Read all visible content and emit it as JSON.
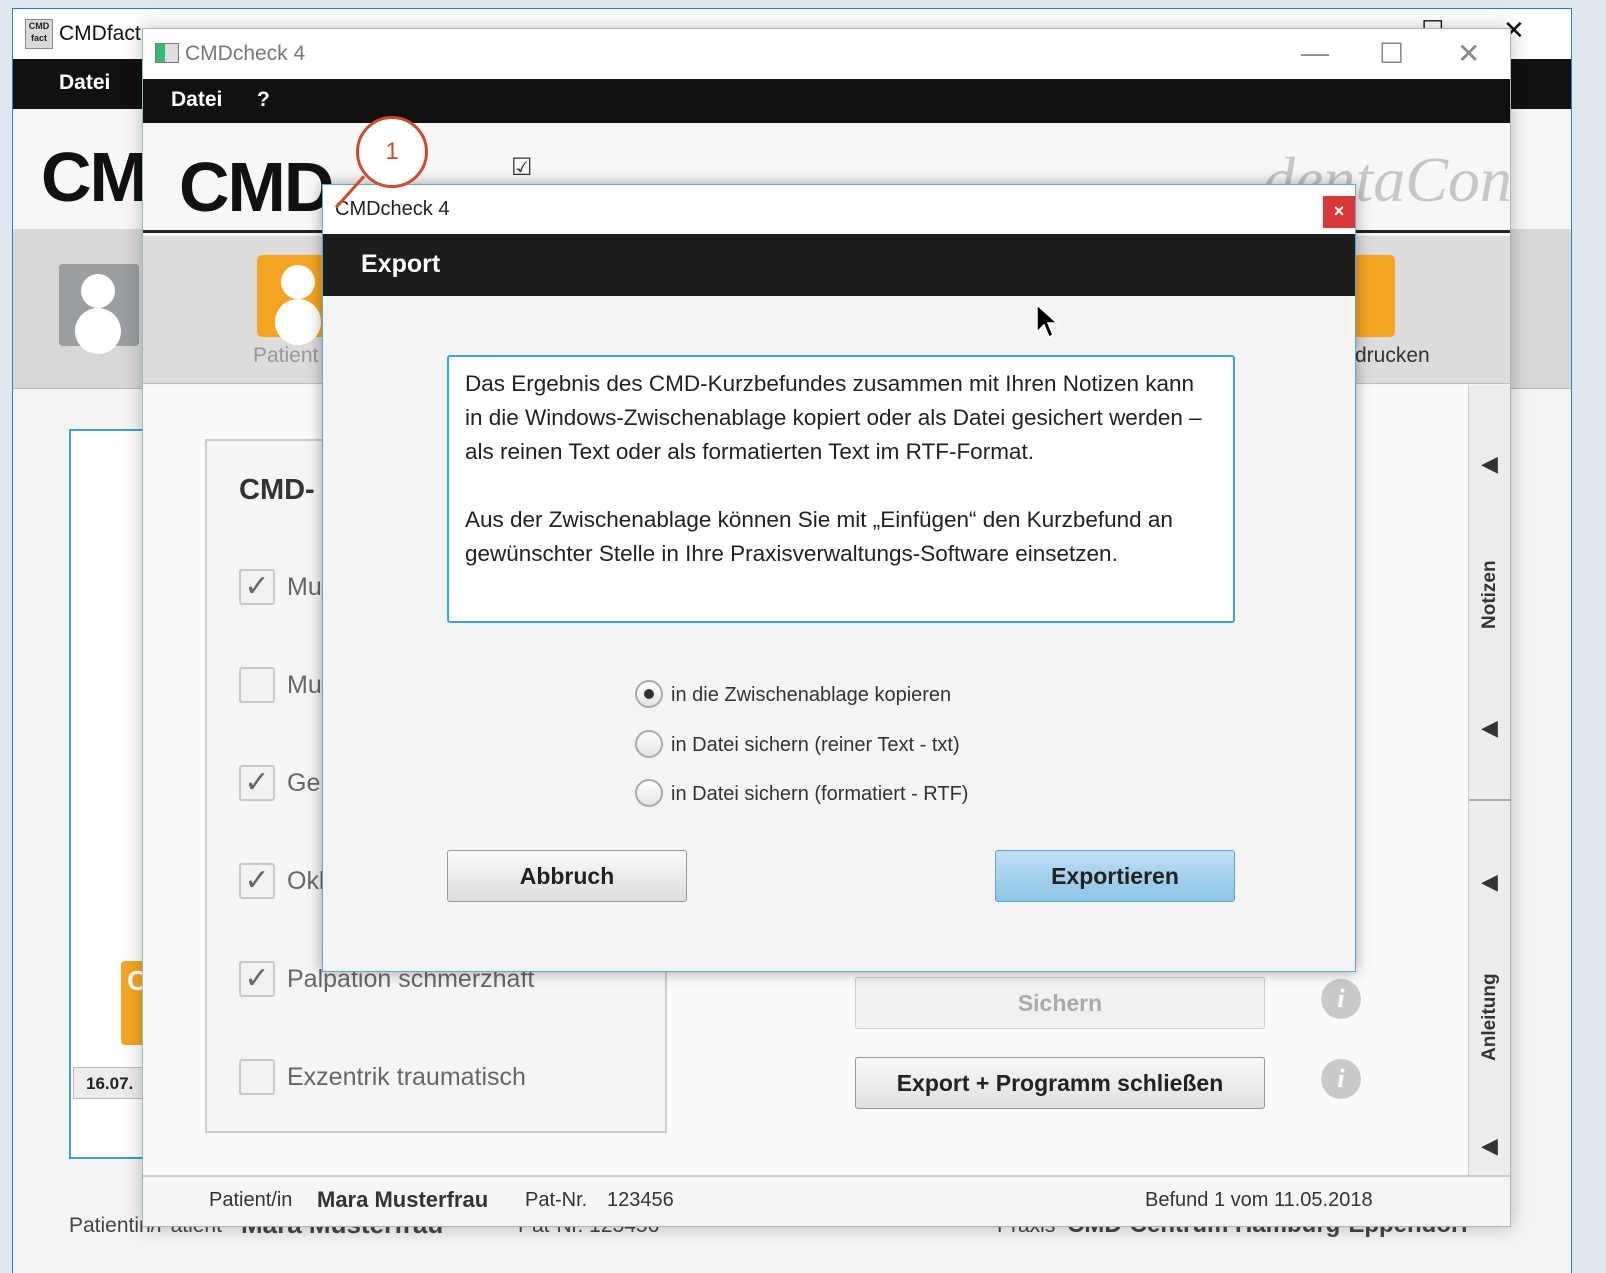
{
  "bg_window": {
    "title": "CMDfact",
    "menu_datei": "Datei",
    "logo_text": "CM",
    "date_chip": "16.07.",
    "orange_letters": "C",
    "status_patient_label": "Patientin/Patient",
    "status_patient_name": "Mara Musterfrau",
    "status_patnr": "Pat-Nr. 123456",
    "status_praxis_label": "Praxis",
    "status_praxis_name": "CMD-Centrum Hamburg-Eppendorf"
  },
  "main_window": {
    "title": "CMDcheck 4",
    "menu": [
      "Datei",
      "?"
    ],
    "logo_text": "CMD",
    "brand": "dentaConcept",
    "toolbar": {
      "patient_label": "Patient",
      "print_label": "drucken"
    },
    "cmd_section_title": "CMD-",
    "checks": [
      {
        "label": "Mu",
        "checked": true
      },
      {
        "label": "Mu",
        "checked": false
      },
      {
        "label": "Gel",
        "checked": true
      },
      {
        "label": "Okl",
        "checked": true
      },
      {
        "label": "Palpation schmerzhaft",
        "checked": true
      },
      {
        "label": "Exzentrik traumatisch",
        "checked": false
      }
    ],
    "buttons": {
      "sichern": "Sichern",
      "export_close": "Export + Programm schließen"
    },
    "rail": {
      "notizen": "Notizen",
      "anleitung": "Anleitung"
    },
    "status": {
      "patient_label": "Patient/in",
      "patient_name": "Mara Musterfrau",
      "patnr_label": "Pat-Nr.",
      "patnr": "123456",
      "befund": "Befund 1 vom 11.05.2018"
    }
  },
  "dialog": {
    "title": "CMDcheck 4",
    "close": "×",
    "header": "Export",
    "text_p1": "Das Ergebnis des CMD-Kurzbefundes zusammen mit Ihren Notizen kann in die Windows-Zwischenablage kopiert oder als Datei gesichert werden – als reinen Text oder als formatierten Text im RTF-Format.",
    "text_p2": "Aus der Zwischenablage können Sie mit „Einfügen“ den Kurzbefund an gewünschter Stelle in Ihre Praxisverwaltungs-Software einsetzen.",
    "options": [
      {
        "label": "in die Zwischenablage kopieren",
        "selected": true
      },
      {
        "label": "in Datei sichern (reiner Text - txt)",
        "selected": false
      },
      {
        "label": "in Datei sichern (formatiert - RTF)",
        "selected": false
      }
    ],
    "btn_cancel": "Abbruch",
    "btn_export": "Exportieren"
  },
  "annotation": {
    "callout_number": "1"
  },
  "icons": [
    "app-icon",
    "user-icon",
    "print-icon",
    "info-icon",
    "triangle-left-icon",
    "mouse-cursor-icon",
    "close-icon"
  ]
}
